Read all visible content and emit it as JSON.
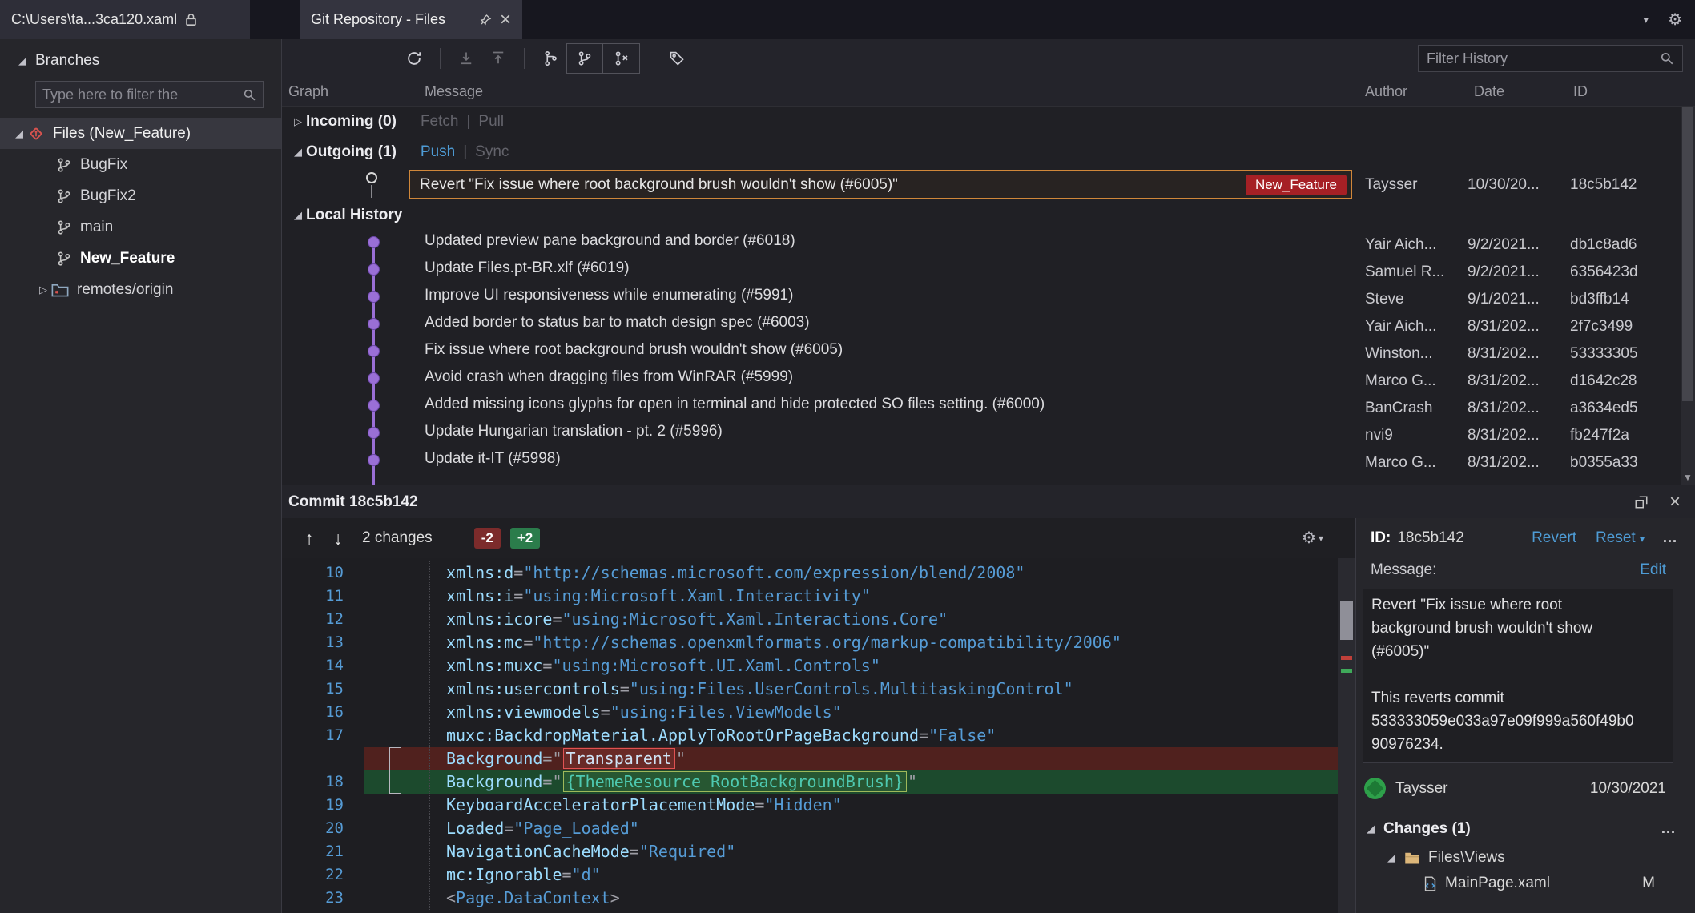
{
  "colors": {
    "link_blue": "#4e9cd6",
    "badge_red": "#a62025",
    "selected_commit_border": "#d0873a",
    "graph_purple": "#9a6fd6",
    "removed_bg": "#50211e",
    "added_bg": "#1c4a2d",
    "added_text": "#4ec9b0",
    "attr_name": "#9cdcfe",
    "attr_value": "#569cd6",
    "line_number": "#569cd6",
    "deletion_badge": "#7c2b2b",
    "addition_badge": "#2b7c4b",
    "avatar_green": "#2ea04a"
  },
  "titlebar": {
    "file_tab": "C:\\Users\\ta...3ca120.xaml",
    "window_tab": "Git Repository - Files"
  },
  "sidebar": {
    "header": "Branches",
    "filter_placeholder": "Type here to filter the",
    "repo_node": "Files (New_Feature)",
    "branches": [
      {
        "label": "BugFix"
      },
      {
        "label": "BugFix2"
      },
      {
        "label": "main"
      },
      {
        "label": "New_Feature",
        "style": "bold"
      }
    ],
    "remotes_node": "remotes/origin"
  },
  "history_toolbar": {
    "filter_placeholder": "Filter History"
  },
  "history": {
    "columns": [
      "Graph",
      "Message",
      "Author",
      "Date",
      "ID"
    ],
    "incoming": {
      "label": "Incoming (0)",
      "fetch": "Fetch",
      "pull": "Pull"
    },
    "outgoing": {
      "label": "Outgoing (1)",
      "push": "Push",
      "sync": "Sync"
    },
    "outgoing_commit": {
      "message": "Revert \"Fix issue where root background brush wouldn't show (#6005)\"",
      "badge": "New_Feature",
      "author": "Taysser",
      "date": "10/30/20...",
      "id": "18c5b142"
    },
    "local_header": "Local History",
    "rows": [
      {
        "message": "Updated preview pane background and border (#6018)",
        "author": "Yair Aich...",
        "date": "9/2/2021...",
        "id": "db1c8ad6"
      },
      {
        "message": "Update Files.pt-BR.xlf (#6019)",
        "author": "Samuel R...",
        "date": "9/2/2021...",
        "id": "6356423d"
      },
      {
        "message": "Improve UI responsiveness while enumerating (#5991)",
        "author": "Steve",
        "date": "9/1/2021...",
        "id": "bd3ffb14"
      },
      {
        "message": "Added border to status bar to match design spec (#6003)",
        "author": "Yair Aich...",
        "date": "8/31/202...",
        "id": "2f7c3499"
      },
      {
        "message": "Fix issue where root background brush wouldn't show (#6005)",
        "author": "Winston...",
        "date": "8/31/202...",
        "id": "53333305"
      },
      {
        "message": "Avoid crash when dragging files from WinRAR (#5999)",
        "author": "Marco G...",
        "date": "8/31/202...",
        "id": "d1642c28"
      },
      {
        "message": "Added missing icons glyphs for open in terminal and hide protected SO files setting. (#6000)",
        "author": "BanCrash",
        "date": "8/31/202...",
        "id": "a3634ed5"
      },
      {
        "message": "Update Hungarian translation - pt. 2 (#5996)",
        "author": "nvi9",
        "date": "8/31/202...",
        "id": "fb247f2a"
      },
      {
        "message": "Update it-IT (#5998)",
        "author": "Marco G...",
        "date": "8/31/202...",
        "id": "b0355a33"
      }
    ]
  },
  "commit_pane": {
    "title": "Commit 18c5b142",
    "changes_label": "2 changes",
    "deletions": "-2",
    "additions": "+2",
    "code_lines": [
      {
        "num": "10",
        "segments": [
          {
            "t": "xmlns:d",
            "c": "a"
          },
          {
            "t": "=",
            "c": "o"
          },
          {
            "t": "\"http://schemas.microsoft.com/expression/blend/2008\"",
            "c": "v"
          }
        ]
      },
      {
        "num": "11",
        "segments": [
          {
            "t": "xmlns:i",
            "c": "a"
          },
          {
            "t": "=",
            "c": "o"
          },
          {
            "t": "\"using:Microsoft.Xaml.Interactivity\"",
            "c": "v"
          }
        ]
      },
      {
        "num": "12",
        "segments": [
          {
            "t": "xmlns:icore",
            "c": "a"
          },
          {
            "t": "=",
            "c": "o"
          },
          {
            "t": "\"using:Microsoft.Xaml.Interactions.Core\"",
            "c": "v"
          }
        ]
      },
      {
        "num": "13",
        "segments": [
          {
            "t": "xmlns:mc",
            "c": "a"
          },
          {
            "t": "=",
            "c": "o"
          },
          {
            "t": "\"http://schemas.openxmlformats.org/markup-compatibility/2006\"",
            "c": "v"
          }
        ]
      },
      {
        "num": "14",
        "segments": [
          {
            "t": "xmlns:muxc",
            "c": "a"
          },
          {
            "t": "=",
            "c": "o"
          },
          {
            "t": "\"using:Microsoft.UI.Xaml.Controls\"",
            "c": "v"
          }
        ]
      },
      {
        "num": "15",
        "segments": [
          {
            "t": "xmlns:usercontrols",
            "c": "a"
          },
          {
            "t": "=",
            "c": "o"
          },
          {
            "t": "\"using:Files.UserControls.MultitaskingControl\"",
            "c": "v"
          }
        ]
      },
      {
        "num": "16",
        "segments": [
          {
            "t": "xmlns:viewmodels",
            "c": "a"
          },
          {
            "t": "=",
            "c": "o"
          },
          {
            "t": "\"using:Files.ViewModels\"",
            "c": "v"
          }
        ]
      },
      {
        "num": "17",
        "segments": [
          {
            "t": "muxc:BackdropMaterial.ApplyToRootOrPageBackground",
            "c": "a"
          },
          {
            "t": "=",
            "c": "o"
          },
          {
            "t": "\"False\"",
            "c": "v"
          }
        ]
      },
      {
        "num": "",
        "type": "removed",
        "segments": [
          {
            "t": "Background",
            "c": "a"
          },
          {
            "t": "=\"",
            "c": "o"
          },
          {
            "t": "Transparent",
            "c": "wr"
          },
          {
            "t": "\"",
            "c": "o"
          }
        ]
      },
      {
        "num": "18",
        "type": "added",
        "segments": [
          {
            "t": "Background",
            "c": "a"
          },
          {
            "t": "=\"",
            "c": "o"
          },
          {
            "t": "{ThemeResource RootBackgroundBrush}",
            "c": "wg"
          },
          {
            "t": "\"",
            "c": "o"
          }
        ]
      },
      {
        "num": "19",
        "segments": [
          {
            "t": "KeyboardAcceleratorPlacementMode",
            "c": "a"
          },
          {
            "t": "=",
            "c": "o"
          },
          {
            "t": "\"Hidden\"",
            "c": "v"
          }
        ]
      },
      {
        "num": "20",
        "segments": [
          {
            "t": "Loaded",
            "c": "a"
          },
          {
            "t": "=",
            "c": "o"
          },
          {
            "t": "\"Page_Loaded\"",
            "c": "v"
          }
        ]
      },
      {
        "num": "21",
        "segments": [
          {
            "t": "NavigationCacheMode",
            "c": "a"
          },
          {
            "t": "=",
            "c": "o"
          },
          {
            "t": "\"Required\"",
            "c": "v"
          }
        ]
      },
      {
        "num": "22",
        "segments": [
          {
            "t": "mc:Ignorable",
            "c": "a"
          },
          {
            "t": "=",
            "c": "o"
          },
          {
            "t": "\"d\"",
            "c": "v"
          }
        ]
      },
      {
        "num": "23",
        "segments": [
          {
            "t": "<",
            "c": "o"
          },
          {
            "t": "Page.DataContext",
            "c": "t"
          },
          {
            "t": ">",
            "c": "o"
          }
        ]
      }
    ]
  },
  "details": {
    "id_label": "ID:",
    "id": "18c5b142",
    "revert": "Revert",
    "reset": "Reset",
    "message_label": "Message:",
    "edit": "Edit",
    "message": "Revert \"Fix issue where root\nbackground brush wouldn't show\n(#6005)\"\n\nThis reverts commit\n533333059e033a97e09f999a560f49b0\n90976234.",
    "author": "Taysser",
    "date": "10/30/2021",
    "changes_header": "Changes (1)",
    "folder": "Files\\Views",
    "file": "MainPage.xaml",
    "file_status": "M"
  }
}
